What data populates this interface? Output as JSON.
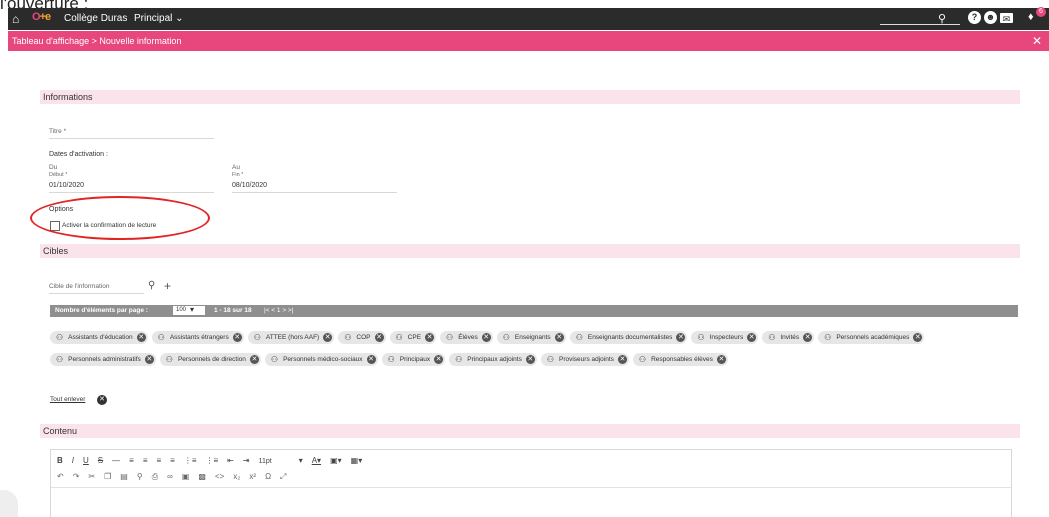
{
  "caption": "l'ouverture :",
  "topbar": {
    "logo_o": "O",
    "logo_e": "+e",
    "school": "Collège Duras",
    "role": "Principal ⌄",
    "notification_count": "6"
  },
  "breadcrumb": "Tableau d'affichage > Nouvelle information",
  "informations": {
    "header": "Informations",
    "title_placeholder": "Titre *",
    "activation_label": "Dates d'activation :",
    "from_label": "Du",
    "from_sub": "Début *",
    "from_value": "01/10/2020",
    "to_label": "Au",
    "to_sub": "Fin *",
    "to_value": "08/10/2020",
    "options_label": "Options",
    "read_confirmation_label": "Activer la confirmation de lecture"
  },
  "cibles": {
    "header": "Cibles",
    "target_placeholder": "Cible de l'information",
    "pager_label": "Nombre d'éléments par page :",
    "page_size": "100",
    "range": "1 - 18 sur 18",
    "pager_nav": "|<  <  1  >  >|",
    "chips": [
      "Assistants d'éducation",
      "Assistants étrangers",
      "ATTEE (hors AAF)",
      "COP",
      "CPE",
      "Élèves",
      "Enseignants",
      "Enseignants documentalistes",
      "Inspecteurs",
      "Invités",
      "Personnels académiques",
      "Personnels administratifs",
      "Personnels de direction",
      "Personnels médico-sociaux",
      "Principaux",
      "Principaux adjoints",
      "Proviseurs adjoints",
      "Responsables élèves"
    ],
    "remove_all": "Tout enlever"
  },
  "contenu": {
    "header": "Contenu",
    "font_size": "11pt"
  }
}
